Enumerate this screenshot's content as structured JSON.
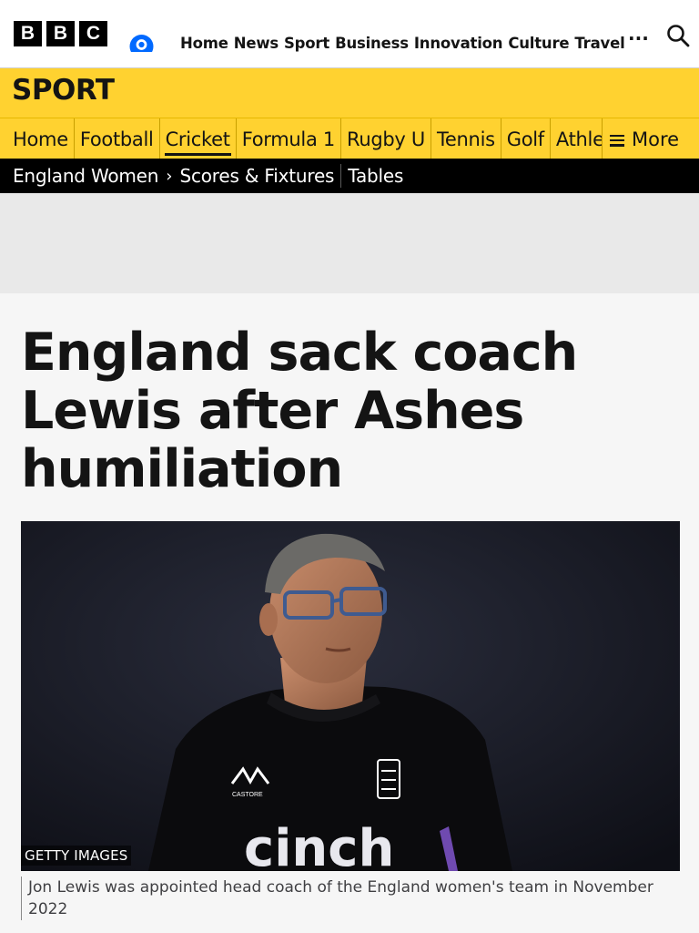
{
  "masthead": {
    "logo_letters": [
      "B",
      "B",
      "C"
    ],
    "nav": [
      "Home",
      "News",
      "Sport",
      "Business",
      "Innovation",
      "Culture",
      "Travel"
    ],
    "more_dots": "···"
  },
  "sport": {
    "title": "SPORT",
    "nav": [
      "Home",
      "Football",
      "Cricket",
      "Formula 1",
      "Rugby U",
      "Tennis",
      "Golf",
      "Athletics"
    ],
    "active": "Cricket",
    "more_label": "More"
  },
  "subnav": {
    "section": "England Women",
    "items": [
      "Scores & Fixtures",
      "Tables"
    ]
  },
  "article": {
    "headline": "England sack coach Lewis after Ashes humiliation",
    "image_credit": "GETTY IMAGES",
    "image_caption": "Jon Lewis was appointed head coach of the England women's team in November 2022",
    "shirt_sponsor": "cinch",
    "shirt_brand": "CASTORE"
  },
  "colors": {
    "sport_yellow": "#ffd230",
    "account_blue": "#0069ff",
    "text": "#141414"
  }
}
